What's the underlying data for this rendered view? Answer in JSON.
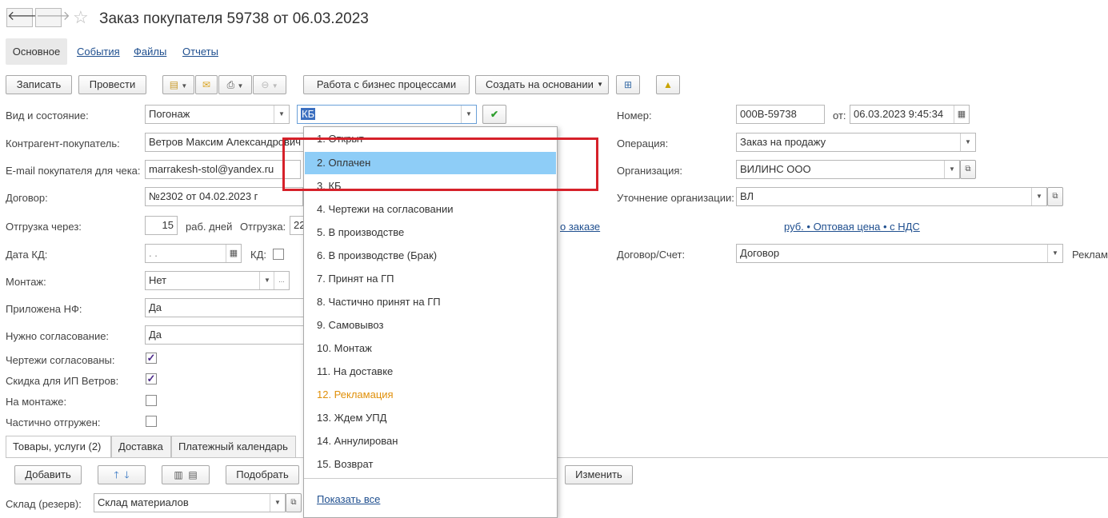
{
  "window": {
    "title": "Заказ покупателя 59738 от 06.03.2023",
    "back": "🡐",
    "forward": "🡒",
    "star": "☆"
  },
  "tabs": {
    "main": "Основное",
    "events": "События",
    "files": "Файлы",
    "reports": "Отчеты"
  },
  "toolbar": {
    "save": "Записать",
    "post": "Провести",
    "business_processes": "Работа с бизнес процессами",
    "create_based_on": "Создать на основании"
  },
  "form": {
    "kind_state_label": "Вид и состояние:",
    "kind_value": "Погонаж",
    "state_value": "КБ",
    "counterparty_label": "Контрагент-покупатель:",
    "counterparty_value": "Ветров Максим Александрович",
    "email_label": "E-mail покупателя для чека:",
    "email_value": "marrakesh-stol@yandex.ru",
    "contract_label": "Договор:",
    "contract_value": "№2302 от 04.02.2023 г",
    "shipment_via_label": "Отгрузка через:",
    "shipment_days": "15",
    "work_days_label": "раб. дней",
    "shipment_label": "Отгрузка:",
    "shipment_value": "22",
    "order_link": "о заказе",
    "kd_date_label": "Дата КД:",
    "kd_date_value": " .  .",
    "kd_label": "КД:",
    "mounting_label": "Монтаж:",
    "mounting_value": "Нет",
    "nf_label": "Приложена НФ:",
    "nf_value": "Да",
    "approval_label": "Нужно согласование:",
    "approval_value": "Да",
    "drawings_label": "Чертежи согласованы:",
    "discount_label": "Скидка для ИП Ветров:",
    "on_mounting_label": "На монтаже:",
    "partially_label": "Частично отгружен:",
    "number_label": "Номер:",
    "number_value": "000В-59738",
    "from_label": "от:",
    "date_value": "06.03.2023  9:45:34",
    "operation_label": "Операция:",
    "operation_value": "Заказ на продажу",
    "organization_label": "Организация:",
    "organization_value": "ВИЛИНС ООО",
    "org_clarify_label": "Уточнение организации:",
    "org_clarify_value": "ВЛ",
    "price_link": "руб. • Оптовая цена • с НДС",
    "contract_account_label": "Договор/Счет:",
    "contract_account_value": "Договор",
    "reclamation_cut": "Реклам"
  },
  "dropdown": {
    "items": [
      "1. Открыт",
      "2. Оплачен",
      "3. КБ",
      "4. Чертежи на согласовании",
      "5. В производстве",
      "6. В производстве (Брак)",
      "7. Принят на ГП",
      "8. Частично принят на ГП",
      "9. Самовывоз",
      "10. Монтаж",
      "11. На доставке",
      "12. Рекламация",
      "13. Ждем УПД",
      "14. Аннулирован",
      "15. Возврат"
    ],
    "selected_index": 1,
    "show_all": "Показать все",
    "colors": {
      "selected_bg": "#8ecdf7",
      "reclamation": "#e0900a",
      "highlight_box": "#d6212a"
    }
  },
  "bottom": {
    "tab_goods": "Товары, услуги (2)",
    "tab_delivery": "Доставка",
    "tab_payment": "Платежный календарь",
    "add": "Добавить",
    "pick": "Подобрать",
    "change": "Изменить",
    "warehouse_label": "Склад (резерв):",
    "warehouse_value": "Склад материалов"
  }
}
